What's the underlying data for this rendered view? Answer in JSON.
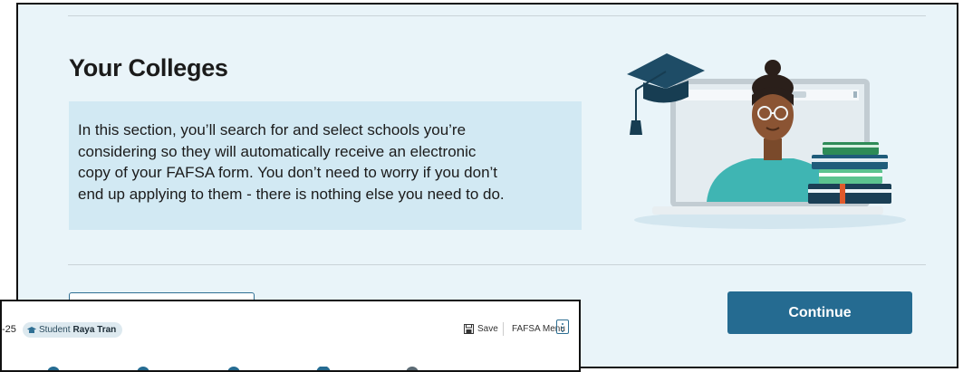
{
  "main": {
    "title": "Your Colleges",
    "info_lines": [
      "In this section, you’ll search for and select schools you’re",
      "considering so they will automatically receive an electronic",
      "copy of your FAFSA form. You don’t need to worry if you don’t",
      "end up applying to them - there is nothing else you need to do."
    ],
    "continue_label": "Continue"
  },
  "inset": {
    "aid_year_fragment": "-25",
    "role_label": "Student",
    "student_name": "Raya Tran",
    "save_label": "Save",
    "menu_label": "FAFSA Menu"
  },
  "colors": {
    "panel_bg": "#e9f4f9",
    "info_bg": "#d2e9f3",
    "accent": "#256b91"
  },
  "icons": [
    "graduation-student-illustration",
    "student-icon",
    "save-icon",
    "kebab-menu-icon",
    "progress-check-icon"
  ]
}
